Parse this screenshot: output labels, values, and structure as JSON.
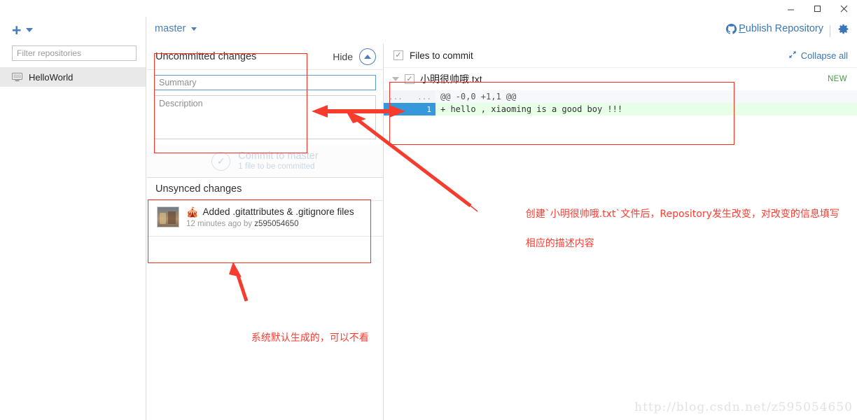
{
  "window": {
    "minimize_label": "Minimize",
    "maximize_label": "Maximize",
    "close_label": "Close"
  },
  "sidebar": {
    "add_icon": "plus-icon",
    "add_caret": "chevron-down-icon",
    "filter_placeholder": "Filter repositories",
    "filter_value": "",
    "repositories": [
      {
        "name": "HelloWorld",
        "icon": "monitor-icon",
        "selected": true
      }
    ]
  },
  "topbar": {
    "branch": "master",
    "branch_caret": "chevron-down-icon",
    "publish_accel": "P",
    "publish_rest": "ublish Repository",
    "publish_full": "Publish Repository",
    "github_icon": "github-icon",
    "settings_icon": "gear-icon"
  },
  "uncommitted": {
    "title": "Uncommitted changes",
    "hide_label": "Hide",
    "hide_icon": "chevron-up-icon",
    "summary_placeholder": "Summary",
    "summary_value": "",
    "description_placeholder": "Description",
    "description_value": "",
    "commit_button": "Commit to master",
    "commit_subtext": "1 file to be committed",
    "commit_icon": "check-circle-icon"
  },
  "unsynced": {
    "title": "Unsynced changes",
    "commits": [
      {
        "emoji": "🎪",
        "message": "Added .gitattributes & .gitignore files",
        "time": "12 minutes ago by",
        "author": "z595054650",
        "avatar": "user-avatar"
      }
    ]
  },
  "files_panel": {
    "header_label": "Files to commit",
    "header_checkbox_checked": true,
    "collapse_all": "Collapse all",
    "collapse_icon": "collapse-arrows-icon",
    "files": [
      {
        "name": "小明很帅哦.txt",
        "status": "NEW",
        "checked": true,
        "expanded": true,
        "diff": [
          {
            "type": "hunk",
            "old_no": "...",
            "new_no": "...",
            "text": "@@ -0,0 +1,1 @@"
          },
          {
            "type": "add",
            "old_no": "",
            "new_no": "1",
            "text": "+ hello , xiaoming is a good boy !!!"
          }
        ]
      }
    ]
  },
  "annotations": [
    {
      "id": "anno-diff",
      "line1": "创建`小明很帅哦.txt`文件后，Repository发生改变，对改变的信息填写",
      "line2": "相应的描述内容"
    },
    {
      "id": "anno-unsynced",
      "line1": "系统默认生成的，可以不看"
    }
  ],
  "watermark": "http://blog.csdn.net/z595054650",
  "colors": {
    "accent_blue": "#4a7ebb",
    "link_blue": "#3a76b8",
    "diff_add_bg": "#e6ffe6",
    "gutter_blue": "#3498db",
    "annotation_red": "#ff3b30",
    "new_badge_green": "#4a9a4a"
  }
}
